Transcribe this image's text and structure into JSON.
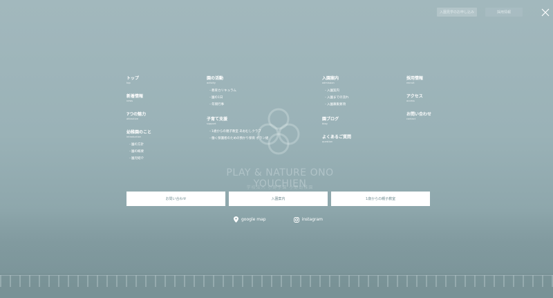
{
  "header": {
    "btn_visit": "入園見学のお申し込み",
    "btn_recruit": "採用情報"
  },
  "bg": {
    "tagline": "PLAY & NATURE ONO YOUCHIEN",
    "subtag": "学校法人 小野学園 小野幼稚園"
  },
  "nav": {
    "col1": [
      {
        "ja": "トップ",
        "en": "top"
      },
      {
        "ja": "新着情報",
        "en": "news"
      },
      {
        "ja": "7つの魅力",
        "en": "attractive"
      },
      {
        "ja": "幼稚園のこと",
        "en": "introduction",
        "sub": [
          "園の方針",
          "園の概要",
          "園児紹介"
        ]
      }
    ],
    "col2": [
      {
        "ja": "園の活動",
        "en": "activity",
        "sub": [
          "教育カリキュラム",
          "園の1日",
          "年間行事"
        ]
      },
      {
        "ja": "子育て支援",
        "en": "support",
        "sub": [
          "1歳からの親子教室 あおむしクラブ",
          "働く保護者のための預かり保育 ポラン組"
        ]
      }
    ],
    "col3": [
      {
        "ja": "入園案内",
        "en": "admission",
        "sub": [
          "入園案内",
          "入園までの流れ",
          "入園募集要項"
        ]
      },
      {
        "ja": "園ブログ",
        "en": "blog"
      },
      {
        "ja": "よくあるご質問",
        "en": "question"
      }
    ],
    "col4": [
      {
        "ja": "採用情報",
        "en": "recruit"
      },
      {
        "ja": "アクセス",
        "en": "access"
      },
      {
        "ja": "お問い合わせ",
        "en": "contact"
      }
    ]
  },
  "cta": {
    "contact": "お問い合わせ",
    "admission": "入園案内",
    "parent_class": "1歳からの親子教室"
  },
  "links": {
    "map": "google map",
    "instagram": "instagram"
  }
}
